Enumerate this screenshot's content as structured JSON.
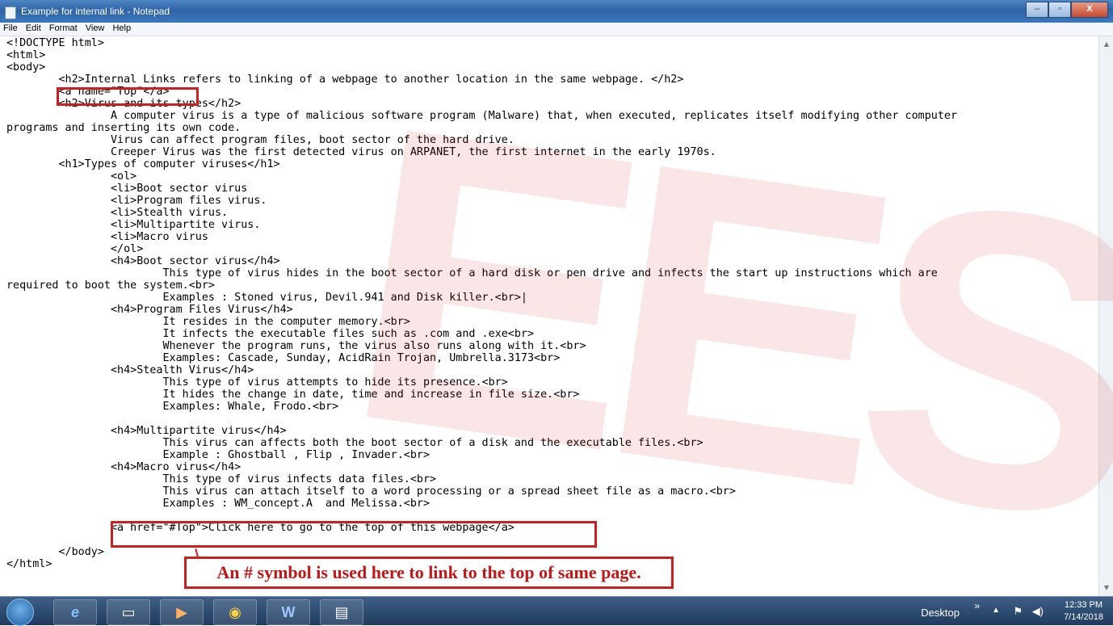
{
  "window": {
    "title": "Example for internal link - Notepad",
    "buttons": [
      "–",
      "▫",
      "X"
    ]
  },
  "menu": [
    "File",
    "Edit",
    "Format",
    "View",
    "Help"
  ],
  "code_text": "<!DOCTYPE html>\n<html>\n<body>\n        <h2>Internal Links refers to linking of a webpage to another location in the same webpage. </h2>\n        <a name=\"Top\"</a>\n        <h2>Virus and its types</h2>\n                A computer virus is a type of malicious software program (Malware) that, when executed, replicates itself modifying other computer\nprograms and inserting its own code.\n                Virus can affect program files, boot sector of the hard drive.\n                Creeper Virus was the first detected virus on ARPANET, the first internet in the early 1970s.\n        <h1>Types of computer viruses</h1>\n                <ol>\n                <li>Boot sector virus\n                <li>Program files virus.\n                <li>Stealth virus.\n                <li>Multipartite virus.\n                <li>Macro virus\n                </ol>\n                <h4>Boot sector virus</h4>\n                        This type of virus hides in the boot sector of a hard disk or pen drive and infects the start up instructions which are\nrequired to boot the system.<br>\n                        Examples : Stoned virus, Devil.941 and Disk killer.<br>|\n                <h4>Program Files Virus</h4>\n                        It resides in the computer memory.<br>\n                        It infects the executable files such as .com and .exe<br>\n                        Whenever the program runs, the virus also runs along with it.<br>\n                        Examples: Cascade, Sunday, AcidRain Trojan, Umbrella.3173<br>\n                <h4>Stealth Virus</h4>\n                        This type of virus attempts to hide its presence.<br>\n                        It hides the change in date, time and increase in file size.<br>\n                        Examples: Whale, Frodo.<br>\n\n                <h4>Multipartite virus</h4>\n                        This virus can affects both the boot sector of a disk and the executable files.<br>\n                        Example : Ghostball , Flip , Invader.<br>\n                <h4>Macro virus</h4>\n                        This type of virus infects data files.<br>\n                        This virus can attach itself to a word processing or a spread sheet file as a macro.<br>\n                        Examples : WM_concept.A  and Melissa.<br>\n\n                <a href=\"#Top\">Click here to go to the top of this webpage</a>\n\n        </body>\n</html>",
  "annotation": "An # symbol is used here to link to the top of same page.",
  "watermark": "EES",
  "taskbar": {
    "apps": [
      "ie-icon",
      "explorer-icon",
      "media-player-icon",
      "chrome-icon",
      "word-icon",
      "notepad-icon"
    ],
    "desktop_label": "Desktop",
    "time": "12:33 PM",
    "date": "7/14/2018"
  },
  "colors": {
    "highlight": "#cc1f1f",
    "titlebar": "#3a6fb0",
    "taskbar": "#1f3a5e"
  }
}
